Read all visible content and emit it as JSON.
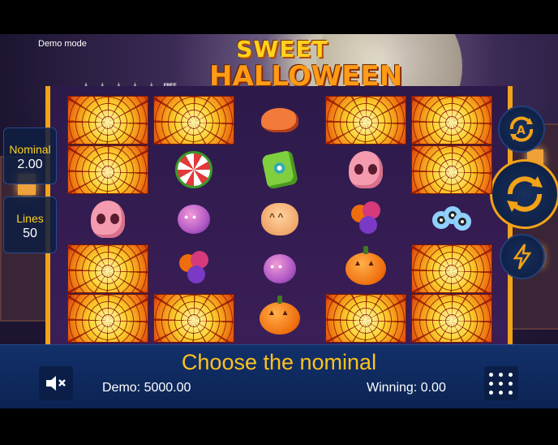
{
  "app": {
    "demo_mode_label": "Demo mode",
    "logo_line1": "SWEET",
    "logo_line2": "HALLOWEEN",
    "free_spins_label": "FREE SPINS"
  },
  "progress": {
    "stars_total": 5,
    "stars_filled": 0
  },
  "left_panel": {
    "nominal_label": "Nominal",
    "nominal_value": "2.00",
    "lines_label": "Lines",
    "lines_value": "50"
  },
  "right_panel": {
    "autoplay_icon": "autoplay-a-icon",
    "spin_icon": "spin-arrow-icon",
    "turbo_icon": "lightning-icon"
  },
  "reels": [
    [
      "web",
      "web",
      "skull",
      "web",
      "web"
    ],
    [
      "web",
      "candy-ring",
      "spider",
      "lollipop",
      "web"
    ],
    [
      "bat",
      "zombie-hand",
      "cat",
      "spider",
      "pumpkin"
    ],
    [
      "web",
      "skull",
      "lollipop",
      "pumpkin",
      "web"
    ],
    [
      "web",
      "web",
      "eyeballs",
      "web",
      "web"
    ]
  ],
  "bottom_bar": {
    "message": "Choose the nominal",
    "demo_balance": "Demo: 5000.00",
    "winning": "Winning: 0.00",
    "sound_icon": "speaker-muted-icon",
    "menu_icon": "menu-dots-icon"
  },
  "colors": {
    "accent_yellow": "#ffc21e",
    "panel_blue": "#12306a",
    "frame_orange": "#f2a318"
  }
}
